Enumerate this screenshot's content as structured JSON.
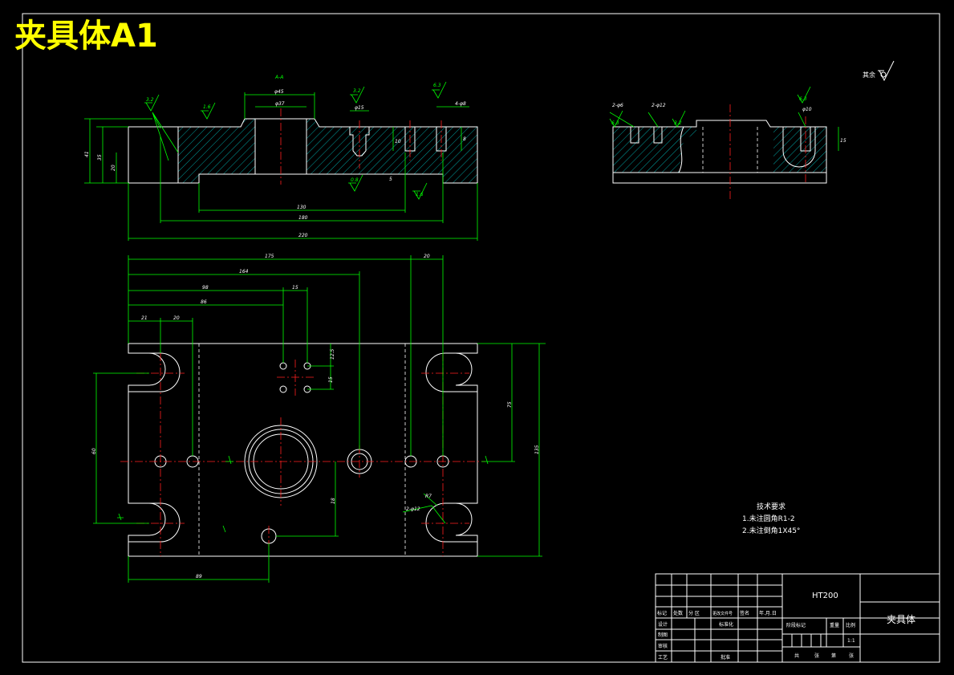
{
  "title": "夹具体A1",
  "roughness_note": "其余",
  "tech_requirements": {
    "heading": "技术要求",
    "items": [
      "1.未注圆角R1-2",
      "2.未注倒角1X45°"
    ]
  },
  "section_label": "A-A",
  "title_block": {
    "material": "HT200",
    "part_name": "夹具体",
    "scale": "1:1",
    "rev_header": [
      "标记",
      "处数",
      "分 区",
      "更改文件号",
      "签名",
      "年.月.日"
    ],
    "row_labels": [
      "设计",
      "制图",
      "审核",
      "工艺"
    ],
    "standardize": "标准化",
    "approve": "批准",
    "stage_mark": "阶段标记",
    "weight": "重量",
    "scale_label": "比例",
    "sheet": [
      "共",
      "张",
      "第",
      "张"
    ]
  },
  "dims_front": {
    "d1": "φ45",
    "d2": "φ37",
    "d3": "φ15",
    "d4": "4-φ8",
    "h1": "41",
    "h2": "35",
    "h3": "20",
    "h4": "10",
    "h5": "8",
    "h6": "5",
    "w1": "130",
    "w2": "180",
    "w3": "220"
  },
  "dims_plan": {
    "d1": "175",
    "d2": "20",
    "d3": "164",
    "d4": "98",
    "d5": "15",
    "d6": "86",
    "d7": "21",
    "d8": "20",
    "d9": "12.5",
    "d10": "15",
    "d11": "75",
    "d12": "135",
    "d13": "60",
    "d14": "18",
    "d15": "89",
    "d16": "2-φ12",
    "d17": "R7"
  },
  "dims_side": {
    "s1": "2-φ6",
    "s2": "2-φ12",
    "s3": "φ10",
    "s4": "15"
  },
  "roughness": {
    "r1": "3.2",
    "r2": "1.6",
    "r3": "3.2",
    "r4": "6.3",
    "r5": "0.8",
    "r6": "1.6",
    "r7": "6.3",
    "r8": "12.5",
    "r9": "3.2",
    "r10": "6.3"
  }
}
